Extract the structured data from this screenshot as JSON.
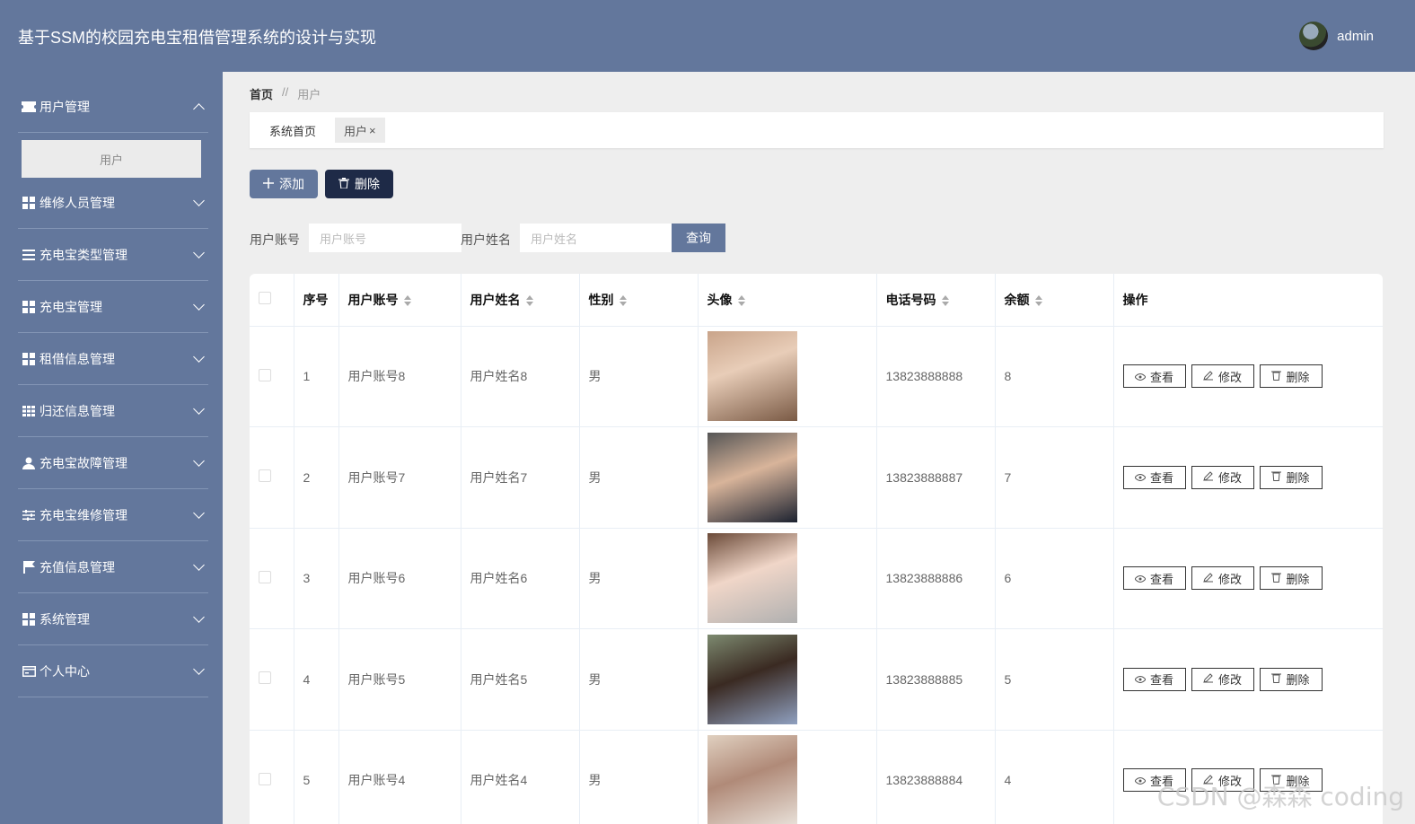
{
  "app": {
    "title": "基于SSM的校园充电宝租借管理系统的设计与实现",
    "user": "admin"
  },
  "sidebar": {
    "items": [
      {
        "label": "用户管理",
        "icon": "ticket-icon",
        "expanded": true
      },
      {
        "label": "维修人员管理",
        "icon": "grid-icon"
      },
      {
        "label": "充电宝类型管理",
        "icon": "list-icon"
      },
      {
        "label": "充电宝管理",
        "icon": "grid-icon"
      },
      {
        "label": "租借信息管理",
        "icon": "grid-icon"
      },
      {
        "label": "归还信息管理",
        "icon": "table-icon"
      },
      {
        "label": "充电宝故障管理",
        "icon": "user-icon"
      },
      {
        "label": "充电宝维修管理",
        "icon": "sliders-icon"
      },
      {
        "label": "充值信息管理",
        "icon": "flag-icon"
      },
      {
        "label": "系统管理",
        "icon": "grid-icon"
      },
      {
        "label": "个人中心",
        "icon": "card-icon"
      }
    ],
    "sub_item": "用户"
  },
  "breadcrumb": {
    "home": "首页",
    "sep": "//",
    "current": "用户"
  },
  "tags": [
    {
      "label": "系统首页"
    },
    {
      "label": "用户",
      "close": "×"
    }
  ],
  "toolbar": {
    "add_label": "添加",
    "delete_label": "删除"
  },
  "search": {
    "account_label": "用户账号",
    "account_placeholder": "用户账号",
    "name_label": "用户姓名",
    "name_placeholder": "用户姓名",
    "query_label": "查询"
  },
  "table": {
    "columns": [
      "序号",
      "用户账号",
      "用户姓名",
      "性别",
      "头像",
      "电话号码",
      "余额",
      "操作"
    ],
    "actions": {
      "view": "查看",
      "edit": "修改",
      "delete": "删除"
    },
    "rows": [
      {
        "index": "1",
        "account": "用户账号8",
        "name": "用户姓名8",
        "gender": "男",
        "phone": "13823888888",
        "balance": "8"
      },
      {
        "index": "2",
        "account": "用户账号7",
        "name": "用户姓名7",
        "gender": "男",
        "phone": "13823888887",
        "balance": "7"
      },
      {
        "index": "3",
        "account": "用户账号6",
        "name": "用户姓名6",
        "gender": "男",
        "phone": "13823888886",
        "balance": "6"
      },
      {
        "index": "4",
        "account": "用户账号5",
        "name": "用户姓名5",
        "gender": "男",
        "phone": "13823888885",
        "balance": "5"
      },
      {
        "index": "5",
        "account": "用户账号4",
        "name": "用户姓名4",
        "gender": "男",
        "phone": "13823888884",
        "balance": "4"
      }
    ]
  },
  "watermark": "CSDN @森森 coding",
  "colors": {
    "primary": "#63779c",
    "dark": "#1e2a47",
    "background": "#eeeeee"
  }
}
